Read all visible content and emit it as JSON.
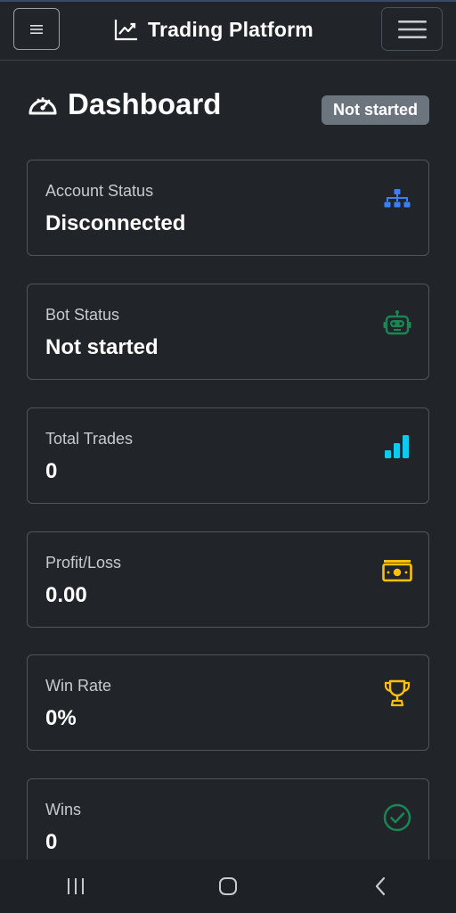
{
  "header": {
    "brand": "Trading Platform",
    "left_button_icon": "hamburger-small-icon",
    "right_button_icon": "hamburger-icon",
    "brand_icon": "chart-line-icon"
  },
  "dashboard": {
    "title": "Dashboard",
    "title_icon": "speedometer-icon",
    "status_badge": "Not started"
  },
  "cards": [
    {
      "label": "Account Status",
      "value": "Disconnected",
      "icon": "diagram-network-icon",
      "color": "#3d7ff5"
    },
    {
      "label": "Bot Status",
      "value": "Not started",
      "icon": "robot-icon",
      "color": "#198754"
    },
    {
      "label": "Total Trades",
      "value": "0",
      "icon": "bar-chart-icon",
      "color": "#0dcaf0"
    },
    {
      "label": "Profit/Loss",
      "value": "0.00",
      "icon": "cash-icon",
      "color": "#ffc107"
    },
    {
      "label": "Win Rate",
      "value": "0%",
      "icon": "trophy-icon",
      "color": "#ffc107"
    },
    {
      "label": "Wins",
      "value": "0",
      "icon": "check-circle-icon",
      "color": "#198754"
    }
  ],
  "system_nav": {
    "recents_icon": "recents-icon",
    "home_icon": "home-icon",
    "back_icon": "back-icon"
  },
  "colors": {
    "background": "#212529",
    "badge": "#6c757d",
    "border": "#50565c"
  }
}
